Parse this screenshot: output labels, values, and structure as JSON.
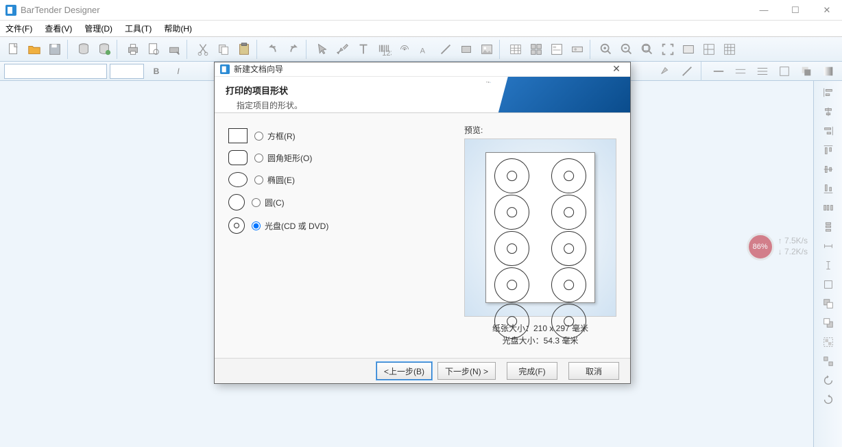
{
  "app": {
    "title": "BarTender Designer"
  },
  "menu": {
    "file": "文件(F)",
    "view": "查看(V)",
    "manage": "管理(D)",
    "tools": "工具(T)",
    "help": "帮助(H)"
  },
  "wizard": {
    "title": "新建文档向导",
    "heading": "打印的项目形状",
    "subheading": "指定项目的形状。",
    "options": {
      "rect": "方框(R)",
      "rounded": "圆角矩形(O)",
      "ellipse": "椭圆(E)",
      "circle": "圆(C)",
      "disc": "光盘(CD 或 DVD)"
    },
    "preview_label": "预览:",
    "paper_size_label": "纸张大小：",
    "paper_size_value": "210 x 297 毫米",
    "disc_size_label": "光盘大小：",
    "disc_size_value": "54.3 毫米",
    "buttons": {
      "back": "<上一步(B)",
      "next": "下一步(N) >",
      "finish": "完成(F)",
      "cancel": "取消"
    }
  },
  "widget": {
    "percent": "86%",
    "up": "7.5K/s",
    "down": "7.2K/s"
  }
}
